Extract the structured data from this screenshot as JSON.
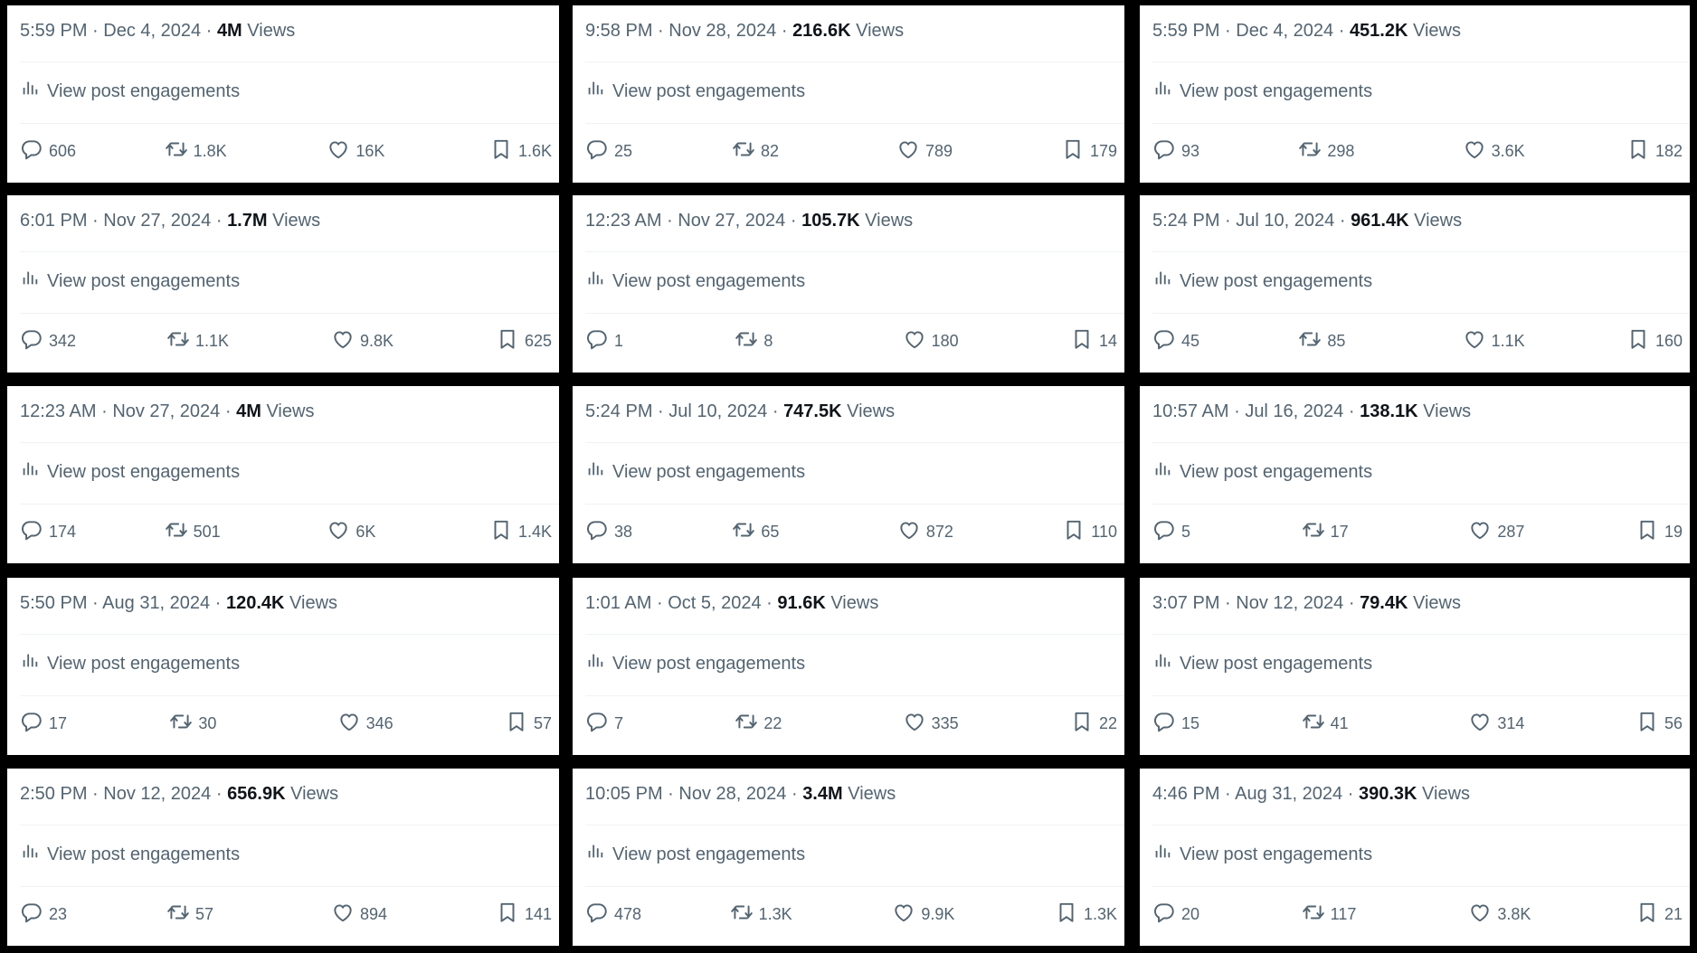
{
  "ui": {
    "engagements_label": "View post engagements",
    "views_word": "Views",
    "separator": "·"
  },
  "icons": {
    "engagements": "bar-chart-icon",
    "reply": "reply-icon",
    "repost": "repost-icon",
    "like": "heart-icon",
    "bookmark": "bookmark-icon"
  },
  "colors": {
    "text_secondary": "#536471",
    "text_primary": "#0f1419",
    "divider": "#eff3f4",
    "frame": "#000000"
  },
  "posts": [
    {
      "time": "5:59 PM",
      "date": "Dec 4, 2024",
      "views": "4M",
      "replies": "606",
      "reposts": "1.8K",
      "likes": "16K",
      "bookmarks": "1.6K"
    },
    {
      "time": "9:58 PM",
      "date": "Nov 28, 2024",
      "views": "216.6K",
      "replies": "25",
      "reposts": "82",
      "likes": "789",
      "bookmarks": "179"
    },
    {
      "time": "5:59 PM",
      "date": "Dec 4, 2024",
      "views": "451.2K",
      "replies": "93",
      "reposts": "298",
      "likes": "3.6K",
      "bookmarks": "182"
    },
    {
      "time": "6:01 PM",
      "date": "Nov 27, 2024",
      "views": "1.7M",
      "replies": "342",
      "reposts": "1.1K",
      "likes": "9.8K",
      "bookmarks": "625"
    },
    {
      "time": "12:23 AM",
      "date": "Nov 27, 2024",
      "views": "105.7K",
      "replies": "1",
      "reposts": "8",
      "likes": "180",
      "bookmarks": "14"
    },
    {
      "time": "5:24 PM",
      "date": "Jul 10, 2024",
      "views": "961.4K",
      "replies": "45",
      "reposts": "85",
      "likes": "1.1K",
      "bookmarks": "160"
    },
    {
      "time": "12:23 AM",
      "date": "Nov 27, 2024",
      "views": "4M",
      "replies": "174",
      "reposts": "501",
      "likes": "6K",
      "bookmarks": "1.4K"
    },
    {
      "time": "5:24 PM",
      "date": "Jul 10, 2024",
      "views": "747.5K",
      "replies": "38",
      "reposts": "65",
      "likes": "872",
      "bookmarks": "110"
    },
    {
      "time": "10:57 AM",
      "date": "Jul 16, 2024",
      "views": "138.1K",
      "replies": "5",
      "reposts": "17",
      "likes": "287",
      "bookmarks": "19"
    },
    {
      "time": "5:50 PM",
      "date": "Aug 31, 2024",
      "views": "120.4K",
      "replies": "17",
      "reposts": "30",
      "likes": "346",
      "bookmarks": "57"
    },
    {
      "time": "1:01 AM",
      "date": "Oct 5, 2024",
      "views": "91.6K",
      "replies": "7",
      "reposts": "22",
      "likes": "335",
      "bookmarks": "22"
    },
    {
      "time": "3:07 PM",
      "date": "Nov 12, 2024",
      "views": "79.4K",
      "replies": "15",
      "reposts": "41",
      "likes": "314",
      "bookmarks": "56"
    },
    {
      "time": "2:50 PM",
      "date": "Nov 12, 2024",
      "views": "656.9K",
      "replies": "23",
      "reposts": "57",
      "likes": "894",
      "bookmarks": "141"
    },
    {
      "time": "10:05 PM",
      "date": "Nov 28, 2024",
      "views": "3.4M",
      "replies": "478",
      "reposts": "1.3K",
      "likes": "9.9K",
      "bookmarks": "1.3K"
    },
    {
      "time": "4:46 PM",
      "date": "Aug 31, 2024",
      "views": "390.3K",
      "replies": "20",
      "reposts": "117",
      "likes": "3.8K",
      "bookmarks": "21"
    }
  ]
}
